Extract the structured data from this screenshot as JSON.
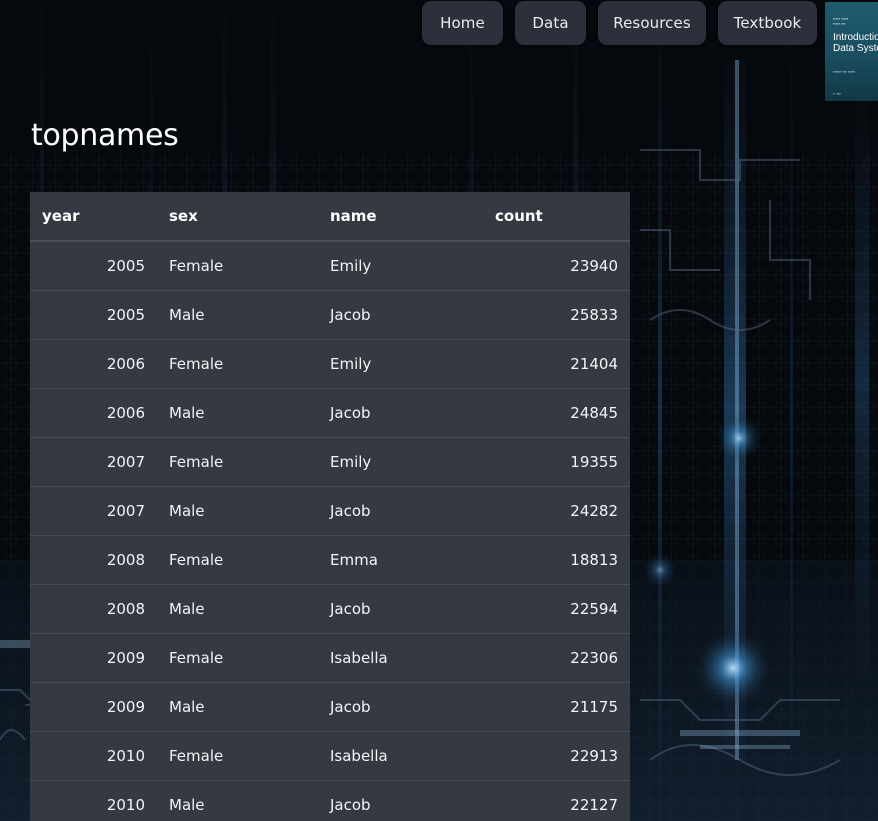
{
  "nav": {
    "items": [
      {
        "label": "Home"
      },
      {
        "label": "Data"
      },
      {
        "label": "Resources"
      },
      {
        "label": "Textbook"
      }
    ]
  },
  "book": {
    "title": "Introduction to Data Systems",
    "cover_color": "#1d5c6e"
  },
  "page": {
    "title": "topnames"
  },
  "table": {
    "columns": [
      "year",
      "sex",
      "name",
      "count"
    ],
    "rows": [
      [
        "2005",
        "Female",
        "Emily",
        "23940"
      ],
      [
        "2005",
        "Male",
        "Jacob",
        "25833"
      ],
      [
        "2006",
        "Female",
        "Emily",
        "21404"
      ],
      [
        "2006",
        "Male",
        "Jacob",
        "24845"
      ],
      [
        "2007",
        "Female",
        "Emily",
        "19355"
      ],
      [
        "2007",
        "Male",
        "Jacob",
        "24282"
      ],
      [
        "2008",
        "Female",
        "Emma",
        "18813"
      ],
      [
        "2008",
        "Male",
        "Jacob",
        "22594"
      ],
      [
        "2009",
        "Female",
        "Isabella",
        "22306"
      ],
      [
        "2009",
        "Male",
        "Jacob",
        "21175"
      ],
      [
        "2010",
        "Female",
        "Isabella",
        "22913"
      ],
      [
        "2010",
        "Male",
        "Jacob",
        "22127"
      ]
    ]
  },
  "colors": {
    "nav_button_bg": "#2b303a",
    "table_bg": "#353a42",
    "page_bg": "#06090e",
    "accent_glow": "#5fb4ff"
  }
}
